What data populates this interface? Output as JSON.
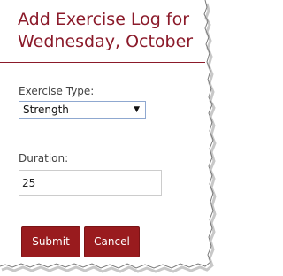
{
  "form": {
    "title_line1": "Add Exercise Log for",
    "title_line2": "Wednesday, October",
    "exercise_type_label": "Exercise Type:",
    "exercise_type_value": "Strength",
    "duration_label": "Duration:",
    "duration_value": "25",
    "submit_label": "Submit",
    "cancel_label": "Cancel"
  },
  "colors": {
    "accent": "#8b1a2a",
    "button": "#991b1e"
  },
  "icons": {
    "select_caret": "chevron-down-icon"
  }
}
